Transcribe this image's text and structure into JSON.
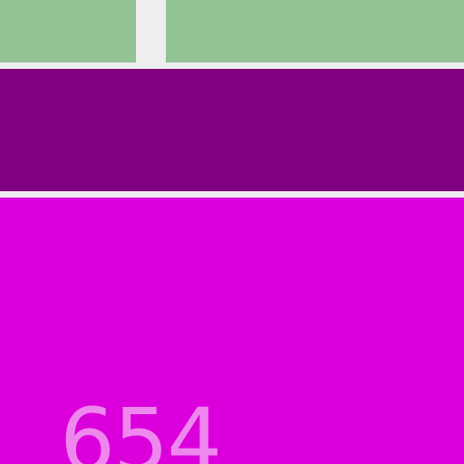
{
  "theme": {
    "background": "#eeeeee",
    "green": "#93c294",
    "purple": "#800080",
    "magenta": "#db00db",
    "count_text": "#ee88ee"
  },
  "tiles": {
    "magenta": {
      "count": "654"
    }
  }
}
